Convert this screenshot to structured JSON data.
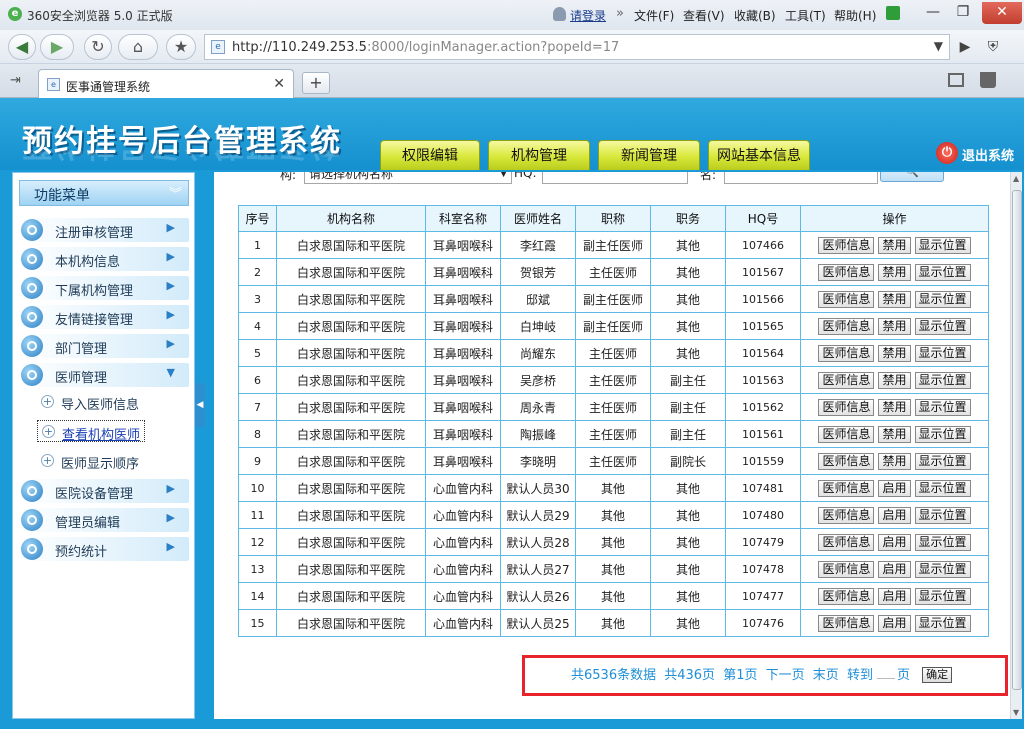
{
  "browser": {
    "title": "360安全浏览器 5.0 正式版",
    "login": "请登录",
    "menu": [
      "文件(F)",
      "查看(V)",
      "收藏(B)",
      "工具(T)",
      "帮助(H)"
    ],
    "url_host": "http://110.249.253.5",
    "url_rest": ":8000/loginManager.action?popeId=17",
    "tab_title": "医事通管理系统"
  },
  "header": {
    "brand": "预约挂号后台管理系统",
    "nav": [
      "权限编辑",
      "机构管理",
      "新闻管理",
      "网站基本信息"
    ],
    "logout": "退出系统"
  },
  "sidebar": {
    "title": "功能菜单",
    "items_top": [
      "注册审核管理",
      "本机构信息",
      "下属机构管理",
      "友情链接管理",
      "部门管理",
      "医师管理"
    ],
    "sub_items": [
      "导入医师信息",
      "查看机构医师",
      "医师显示顺序"
    ],
    "items_bottom": [
      "医院设备管理",
      "管理员编辑",
      "预约统计"
    ]
  },
  "filter": {
    "org_label": "构:",
    "org_select": "请选择机构名称",
    "hq_label": "HQ:",
    "name_label": "名:"
  },
  "table": {
    "headers": [
      "序号",
      "机构名称",
      "科室名称",
      "医师姓名",
      "职称",
      "职务",
      "HQ号",
      "操作"
    ],
    "rows": [
      [
        "1",
        "白求恩国际和平医院",
        "耳鼻咽喉科",
        "李红霞",
        "副主任医师",
        "其他",
        "107466",
        "禁用"
      ],
      [
        "2",
        "白求恩国际和平医院",
        "耳鼻咽喉科",
        "贺银芳",
        "主任医师",
        "其他",
        "101567",
        "禁用"
      ],
      [
        "3",
        "白求恩国际和平医院",
        "耳鼻咽喉科",
        "邸斌",
        "副主任医师",
        "其他",
        "101566",
        "禁用"
      ],
      [
        "4",
        "白求恩国际和平医院",
        "耳鼻咽喉科",
        "白坤岐",
        "副主任医师",
        "其他",
        "101565",
        "禁用"
      ],
      [
        "5",
        "白求恩国际和平医院",
        "耳鼻咽喉科",
        "尚耀东",
        "主任医师",
        "其他",
        "101564",
        "禁用"
      ],
      [
        "6",
        "白求恩国际和平医院",
        "耳鼻咽喉科",
        "吴彦桥",
        "主任医师",
        "副主任",
        "101563",
        "禁用"
      ],
      [
        "7",
        "白求恩国际和平医院",
        "耳鼻咽喉科",
        "周永青",
        "主任医师",
        "副主任",
        "101562",
        "禁用"
      ],
      [
        "8",
        "白求恩国际和平医院",
        "耳鼻咽喉科",
        "陶振峰",
        "主任医师",
        "副主任",
        "101561",
        "禁用"
      ],
      [
        "9",
        "白求恩国际和平医院",
        "耳鼻咽喉科",
        "李晓明",
        "主任医师",
        "副院长",
        "101559",
        "禁用"
      ],
      [
        "10",
        "白求恩国际和平医院",
        "心血管内科",
        "默认人员30",
        "其他",
        "其他",
        "107481",
        "启用"
      ],
      [
        "11",
        "白求恩国际和平医院",
        "心血管内科",
        "默认人员29",
        "其他",
        "其他",
        "107480",
        "启用"
      ],
      [
        "12",
        "白求恩国际和平医院",
        "心血管内科",
        "默认人员28",
        "其他",
        "其他",
        "107479",
        "启用"
      ],
      [
        "13",
        "白求恩国际和平医院",
        "心血管内科",
        "默认人员27",
        "其他",
        "其他",
        "107478",
        "启用"
      ],
      [
        "14",
        "白求恩国际和平医院",
        "心血管内科",
        "默认人员26",
        "其他",
        "其他",
        "107477",
        "启用"
      ],
      [
        "15",
        "白求恩国际和平医院",
        "心血管内科",
        "默认人员25",
        "其他",
        "其他",
        "107476",
        "启用"
      ]
    ],
    "op_info": "医师信息",
    "op_location": "显示位置"
  },
  "pager": {
    "total": "共6536条数据",
    "pages": "共436页",
    "current": "第1页",
    "next": "下一页",
    "last": "末页",
    "goto": "转到",
    "page_unit": "页",
    "ok": "确定"
  },
  "colors": {
    "header_blue": "#1590cf",
    "nav_tab_yellow": "#d8e83a",
    "table_border": "#5dbae7",
    "pager_highlight": "#e8232b",
    "pager_text": "#1f8ed6"
  }
}
